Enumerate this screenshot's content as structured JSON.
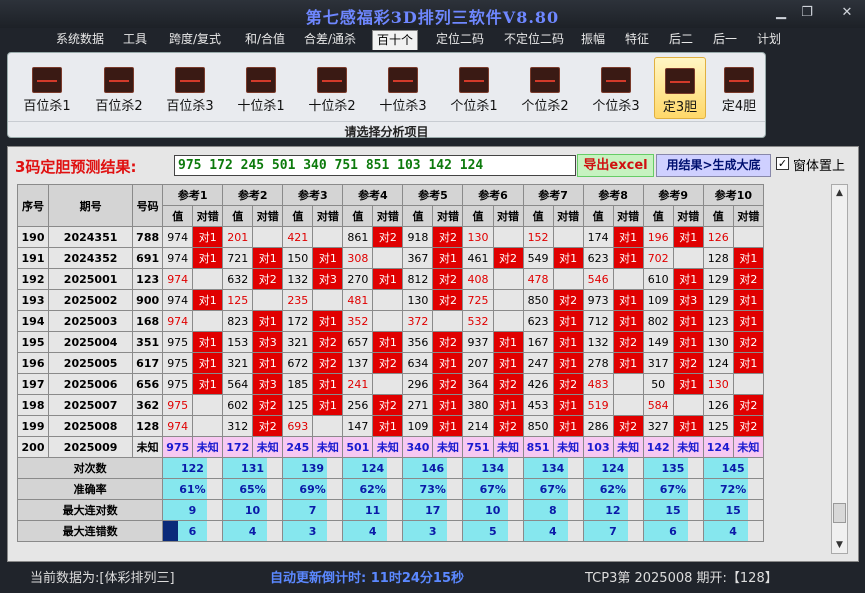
{
  "window": {
    "title": "第七感福彩3D排列三软件V8.80"
  },
  "menu": [
    "系统数据",
    "工具",
    "跨度/复式",
    "和/合值",
    "合差/通杀",
    "百十个",
    "定位二码",
    "不定位二码",
    "振幅",
    "特征",
    "后二",
    "后一",
    "计划"
  ],
  "menu_active": 5,
  "ribbon": {
    "buttons": [
      "百位杀1",
      "百位杀2",
      "百位杀3",
      "十位杀1",
      "十位杀2",
      "十位杀3",
      "个位杀1",
      "个位杀2",
      "个位杀3",
      "定3胆",
      "定4胆"
    ],
    "selected": 9,
    "caption": "请选择分析项目"
  },
  "prediction": {
    "label": "3码定胆预测结果:",
    "value": "975 172 245 501 340 751 851 103 142 124",
    "excel_label": "导出excel",
    "generate_label": "用结果>生成大底",
    "topmost_label": "窗体置上",
    "topmost_checked": "✓"
  },
  "table": {
    "head1": [
      "序号",
      "期号",
      "号码"
    ],
    "refs": [
      "参考1",
      "参考2",
      "参考3",
      "参考4",
      "参考5",
      "参考6",
      "参考7",
      "参考8",
      "参考9",
      "参考10"
    ],
    "sub": [
      "值",
      "对错"
    ],
    "rows": [
      {
        "n": "190",
        "issue": "2024351",
        "code": "788",
        "cells": [
          [
            "974",
            "b",
            "对1"
          ],
          [
            "201",
            "r",
            ""
          ],
          [
            "421",
            "r",
            ""
          ],
          [
            "861",
            "b",
            "对2"
          ],
          [
            "918",
            "b",
            "对2"
          ],
          [
            "130",
            "r",
            ""
          ],
          [
            "152",
            "r",
            ""
          ],
          [
            "174",
            "b",
            "对1"
          ],
          [
            "196",
            "r",
            "对1"
          ],
          [
            "126",
            "r",
            ""
          ]
        ]
      },
      {
        "n": "191",
        "issue": "2024352",
        "code": "691",
        "cells": [
          [
            "974",
            "b",
            "对1"
          ],
          [
            "721",
            "b",
            "对1"
          ],
          [
            "150",
            "b",
            "对1"
          ],
          [
            "308",
            "r",
            ""
          ],
          [
            "367",
            "b",
            "对1"
          ],
          [
            "461",
            "b",
            "对2"
          ],
          [
            "549",
            "b",
            "对1"
          ],
          [
            "623",
            "b",
            "对1"
          ],
          [
            "702",
            "r",
            ""
          ],
          [
            "128",
            "b",
            "对1"
          ]
        ]
      },
      {
        "n": "192",
        "issue": "2025001",
        "code": "123",
        "cells": [
          [
            "974",
            "r",
            ""
          ],
          [
            "632",
            "b",
            "对2"
          ],
          [
            "132",
            "b",
            "对3"
          ],
          [
            "270",
            "b",
            "对1"
          ],
          [
            "812",
            "b",
            "对2"
          ],
          [
            "408",
            "r",
            ""
          ],
          [
            "478",
            "r",
            ""
          ],
          [
            "546",
            "r",
            ""
          ],
          [
            "610",
            "b",
            "对1"
          ],
          [
            "129",
            "b",
            "对2"
          ]
        ]
      },
      {
        "n": "193",
        "issue": "2025002",
        "code": "900",
        "cells": [
          [
            "974",
            "b",
            "对1"
          ],
          [
            "125",
            "r",
            ""
          ],
          [
            "235",
            "r",
            ""
          ],
          [
            "481",
            "r",
            ""
          ],
          [
            "130",
            "b",
            "对2"
          ],
          [
            "725",
            "r",
            ""
          ],
          [
            "850",
            "b",
            "对2"
          ],
          [
            "973",
            "b",
            "对1"
          ],
          [
            "109",
            "b",
            "对3"
          ],
          [
            "129",
            "b",
            "对1"
          ]
        ]
      },
      {
        "n": "194",
        "issue": "2025003",
        "code": "168",
        "cells": [
          [
            "974",
            "r",
            ""
          ],
          [
            "823",
            "b",
            "对1"
          ],
          [
            "172",
            "b",
            "对1"
          ],
          [
            "352",
            "r",
            ""
          ],
          [
            "372",
            "r",
            ""
          ],
          [
            "532",
            "r",
            ""
          ],
          [
            "623",
            "b",
            "对1"
          ],
          [
            "712",
            "b",
            "对1"
          ],
          [
            "802",
            "b",
            "对1"
          ],
          [
            "123",
            "b",
            "对1"
          ]
        ]
      },
      {
        "n": "195",
        "issue": "2025004",
        "code": "351",
        "cells": [
          [
            "975",
            "b",
            "对1"
          ],
          [
            "153",
            "b",
            "对3"
          ],
          [
            "321",
            "b",
            "对2"
          ],
          [
            "657",
            "b",
            "对1"
          ],
          [
            "356",
            "b",
            "对2"
          ],
          [
            "937",
            "b",
            "对1"
          ],
          [
            "167",
            "b",
            "对1"
          ],
          [
            "132",
            "b",
            "对2"
          ],
          [
            "149",
            "b",
            "对1"
          ],
          [
            "130",
            "b",
            "对2"
          ]
        ]
      },
      {
        "n": "196",
        "issue": "2025005",
        "code": "617",
        "cells": [
          [
            "975",
            "b",
            "对1"
          ],
          [
            "321",
            "b",
            "对1"
          ],
          [
            "672",
            "b",
            "对2"
          ],
          [
            "137",
            "b",
            "对2"
          ],
          [
            "634",
            "b",
            "对1"
          ],
          [
            "207",
            "b",
            "对1"
          ],
          [
            "247",
            "b",
            "对1"
          ],
          [
            "278",
            "b",
            "对1"
          ],
          [
            "317",
            "b",
            "对2"
          ],
          [
            "124",
            "b",
            "对1"
          ]
        ]
      },
      {
        "n": "197",
        "issue": "2025006",
        "code": "656",
        "cells": [
          [
            "975",
            "b",
            "对1"
          ],
          [
            "564",
            "b",
            "对3"
          ],
          [
            "185",
            "b",
            "对1"
          ],
          [
            "241",
            "r",
            ""
          ],
          [
            "296",
            "b",
            "对2"
          ],
          [
            "364",
            "b",
            "对2"
          ],
          [
            "426",
            "b",
            "对2"
          ],
          [
            "483",
            "r",
            ""
          ],
          [
            "50",
            "b",
            "对1"
          ],
          [
            "130",
            "r",
            ""
          ]
        ]
      },
      {
        "n": "198",
        "issue": "2025007",
        "code": "362",
        "cells": [
          [
            "975",
            "r",
            ""
          ],
          [
            "602",
            "b",
            "对2"
          ],
          [
            "125",
            "b",
            "对1"
          ],
          [
            "256",
            "b",
            "对2"
          ],
          [
            "271",
            "b",
            "对1"
          ],
          [
            "380",
            "b",
            "对1"
          ],
          [
            "453",
            "b",
            "对1"
          ],
          [
            "519",
            "r",
            ""
          ],
          [
            "584",
            "r",
            ""
          ],
          [
            "126",
            "b",
            "对2"
          ]
        ]
      },
      {
        "n": "199",
        "issue": "2025008",
        "code": "128",
        "cells": [
          [
            "974",
            "r",
            ""
          ],
          [
            "312",
            "b",
            "对2"
          ],
          [
            "693",
            "r",
            ""
          ],
          [
            "147",
            "b",
            "对1"
          ],
          [
            "109",
            "b",
            "对1"
          ],
          [
            "214",
            "b",
            "对2"
          ],
          [
            "850",
            "b",
            "对1"
          ],
          [
            "286",
            "b",
            "对2"
          ],
          [
            "327",
            "b",
            "对1"
          ],
          [
            "125",
            "b",
            "对2"
          ]
        ]
      }
    ],
    "pred_row": {
      "n": "200",
      "issue": "2025009",
      "code": "未知",
      "vals": [
        "975",
        "172",
        "245",
        "501",
        "340",
        "751",
        "851",
        "103",
        "142",
        "124"
      ],
      "unknown": "未知"
    },
    "stats": [
      {
        "label": "对次数",
        "vals": [
          "122",
          "131",
          "139",
          "124",
          "146",
          "134",
          "134",
          "124",
          "135",
          "145"
        ]
      },
      {
        "label": "准确率",
        "vals": [
          "61%",
          "65%",
          "69%",
          "62%",
          "73%",
          "67%",
          "67%",
          "62%",
          "67%",
          "72%"
        ]
      },
      {
        "label": "最大连对数",
        "vals": [
          "9",
          "10",
          "7",
          "11",
          "17",
          "10",
          "8",
          "12",
          "15",
          "15"
        ]
      },
      {
        "label": "最大连错数",
        "vals": [
          "6",
          "4",
          "3",
          "4",
          "3",
          "5",
          "4",
          "7",
          "6",
          "4"
        ]
      }
    ]
  },
  "status": {
    "left": "当前数据为:[体彩排列三]",
    "center": "自动更新倒计时: 11时24分15秒",
    "right": "TCP3第 2025008 期开:【128】"
  },
  "colors": {
    "hit": "#e00000",
    "pred_bg": "#f7c8f2",
    "stat_bg": "#86e7ee",
    "title": "#6e87ff"
  }
}
